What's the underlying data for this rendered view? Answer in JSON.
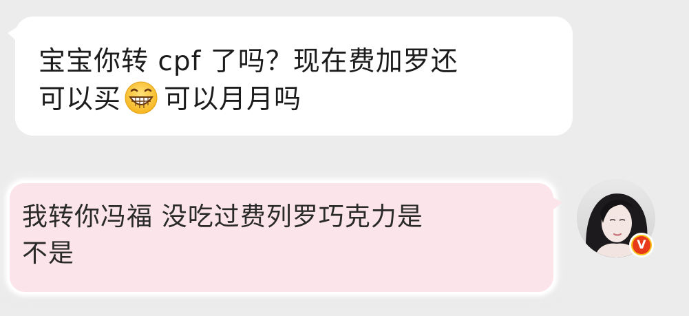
{
  "conversation": {
    "incoming": {
      "line1": "宝宝你转 cpf 了吗？现在费加罗还",
      "line2_before": "可以买",
      "emoji": "grinning-face",
      "line2_after": "可以月月吗"
    },
    "outgoing": {
      "line1": "我转你冯福 没吃过费列罗巧克力是",
      "line2": "不是",
      "sender_avatar": "avatar-photo",
      "badge_glyph": "V"
    }
  },
  "colors": {
    "background": "#ececec",
    "incoming_bubble": "#ffffff",
    "outgoing_bubble": "#fbe5ea",
    "badge_outer": "#f7c21a",
    "badge_inner": "#e8391b"
  }
}
